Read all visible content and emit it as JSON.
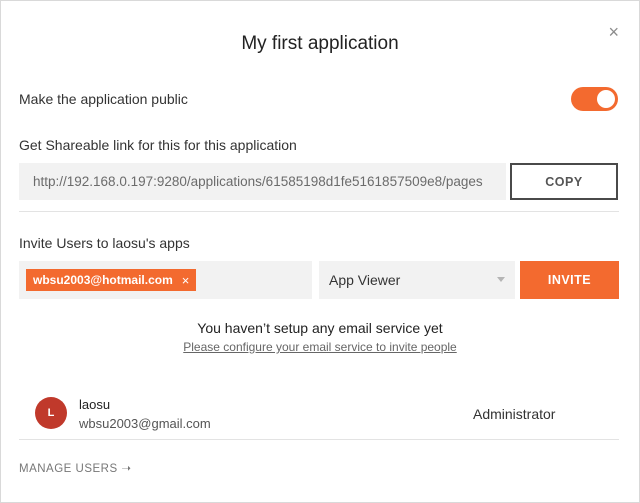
{
  "modal": {
    "title": "My first application",
    "close_glyph": "×"
  },
  "public_setting": {
    "label": "Make the application public",
    "enabled": true
  },
  "share": {
    "label": "Get Shareable link for this for this application",
    "link_value": "http://192.168.0.197:9280/applications/61585198d1fe5161857509e8/pages",
    "copy_label": "COPY"
  },
  "invite": {
    "label": "Invite Users to laosu's apps",
    "tags": [
      {
        "email": "wbsu2003@hotmail.com",
        "remove_glyph": "×"
      }
    ],
    "role_selected": "App Viewer",
    "invite_label": "INVITE",
    "notice_title": "You haven’t setup any email service yet",
    "notice_link": "Please configure your email service to invite people"
  },
  "users": [
    {
      "initial": "L",
      "name": "laosu",
      "email": "wbsu2003@gmail.com",
      "role": "Administrator"
    }
  ],
  "footer": {
    "manage_users_label": "MANAGE USERS ➝"
  },
  "colors": {
    "accent": "#f36a2f",
    "avatar": "#c0392b"
  },
  "icons": {
    "close": "close-icon",
    "tag_remove": "close-icon",
    "dropdown": "chevron-down-icon",
    "arrow": "arrow-right-icon"
  }
}
